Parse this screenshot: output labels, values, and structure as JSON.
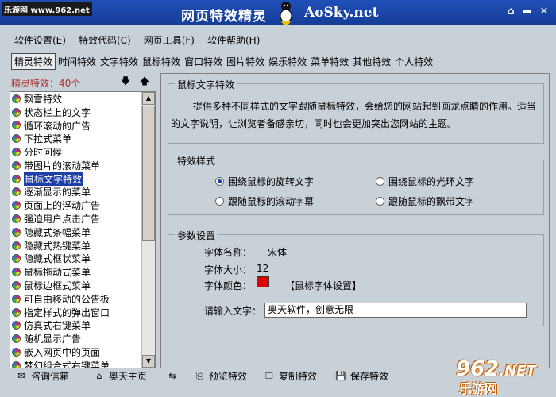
{
  "watermark": {
    "top_left": "乐游网 www.962.net",
    "bottom_right_number": "962",
    "bottom_right_suffix": ".NET",
    "bottom_right_cn": "乐游网"
  },
  "window": {
    "title": "网页特效精灵",
    "site": "AoSky.net"
  },
  "menu": [
    "软件设置(E)",
    "特效代码(C)",
    "网页工具(F)",
    "软件帮助(H)"
  ],
  "tabs": [
    "精灵特效",
    "时间特效",
    "文字特效",
    "鼠标特效",
    "窗口特效",
    "图片特效",
    "娱乐特效",
    "菜单特效",
    "其他特效",
    "个人特效"
  ],
  "active_tab": 0,
  "left_panel": {
    "title": "精灵特效：40个"
  },
  "effects_list": [
    "飘雪特效",
    "状态栏上的文字",
    "循环滚动的广告",
    "下拉式菜单",
    "分时问候",
    "带图片的滚动菜单",
    "鼠标文字特效",
    "逐渐显示的菜单",
    "页面上的浮动广告",
    "强迫用户点击广告",
    "隐藏式条幅菜单",
    "隐藏式热键菜单",
    "隐藏式框状菜单",
    "鼠标拖动式菜单",
    "鼠标边框式菜单",
    "可自由移动的公告板",
    "指定样式的弹出窗口",
    "仿真式右键菜单",
    "随机显示广告",
    "嵌入网页中的页面",
    "梦幻组合式右键菜单"
  ],
  "selected_index": 6,
  "description": {
    "title": "鼠标文字特效",
    "text": "提供多种不同样式的文字跟随鼠标特效，会给您的网站起到画龙点睛的作用。适当的文字说明，让浏览者备感亲切，同时也会更加突出您网站的主题。"
  },
  "effect_style": {
    "title": "特效样式",
    "options": [
      "围绕鼠标的旋转文字",
      "围绕鼠标的光环文字",
      "跟随鼠标的滚动字幕",
      "跟随鼠标的飘带文字"
    ],
    "selected": 0
  },
  "params": {
    "title": "参数设置",
    "font_name_label": "字体名称：",
    "font_name_value": "宋体",
    "font_size_label": "字体大小：",
    "font_size_value": "12",
    "font_color_label": "字体颜色：",
    "font_color": "#e00000",
    "font_settings_link": "【鼠标字体设置】",
    "input_label": "请输入文字：",
    "input_value": "奥天软件，创意无限"
  },
  "bottom_buttons": {
    "consult": "咨询信箱",
    "home": "奥天主页",
    "preview": "预览特效",
    "copy": "复制特效",
    "save": "保存特效"
  }
}
